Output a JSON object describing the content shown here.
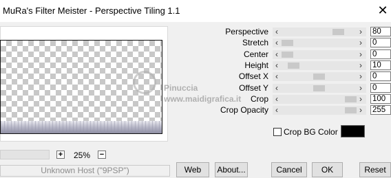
{
  "window": {
    "title": "MuRa's Filter Meister - Perspective Tiling 1.1",
    "close_glyph": "✕"
  },
  "params": [
    {
      "label": "Perspective",
      "value": "80",
      "fraction": 0.8
    },
    {
      "label": "Stretch",
      "value": "0",
      "fraction": 0.0
    },
    {
      "label": "Center",
      "value": "0",
      "fraction": 0.0
    },
    {
      "label": "Height",
      "value": "10",
      "fraction": 0.1
    },
    {
      "label": "Offset X",
      "value": "0",
      "fraction": 0.5
    },
    {
      "label": "Offset Y",
      "value": "0",
      "fraction": 0.5
    },
    {
      "label": "Crop",
      "value": "100",
      "fraction": 1.0
    },
    {
      "label": "Crop Opacity",
      "value": "255",
      "fraction": 1.0
    }
  ],
  "crop_bg": {
    "label": "Crop BG Color",
    "checked": false,
    "color": "#000000"
  },
  "zoom": {
    "plus": "+",
    "minus": "−",
    "value": "25%"
  },
  "host": "Unknown Host (\"9PSP\")",
  "buttons": {
    "web": "Web",
    "about": "About...",
    "cancel": "Cancel",
    "ok": "OK",
    "reset": "Reset"
  },
  "watermark": {
    "line1": "Pinuccia",
    "line2": "www.maidigrafica.it"
  },
  "arrows": {
    "left": "‹",
    "right": "›"
  }
}
